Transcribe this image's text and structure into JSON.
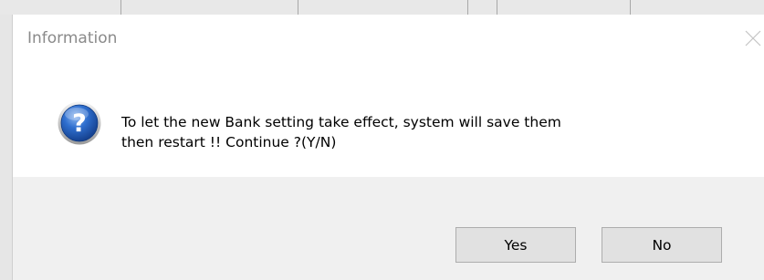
{
  "dialog": {
    "title": "Information",
    "message": "To let the new Bank setting take effect, system will save them\nthen restart !! Continue ?(Y/N)",
    "icon": "question-icon",
    "buttons": {
      "yes_label": "Yes",
      "no_label": "No"
    },
    "close_icon": "close-icon"
  },
  "colors": {
    "dialog_background": "#ffffff",
    "footer_background": "#f0f0f0",
    "title_text": "#8a8a8a",
    "button_face": "#e1e1e1",
    "button_border": "#adadad",
    "icon_blue": "#1f5fb5"
  }
}
